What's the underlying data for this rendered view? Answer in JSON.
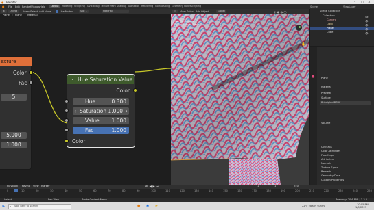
{
  "window": {
    "title": "Blender"
  },
  "menu": [
    "File",
    "Edit",
    "Render",
    "Window",
    "Help"
  ],
  "workspaces": [
    "Layout",
    "Modeling",
    "Sculpting",
    "UV Editing",
    "Texture Paint",
    "Shading",
    "Animation",
    "Rendering",
    "Compositing",
    "Geometry Nodes",
    "Scripting"
  ],
  "active_workspace": "Layout",
  "scene": "Scene",
  "view_layer": "ViewLayer",
  "node_editor": {
    "header": {
      "editor": "Object",
      "menus": [
        "View",
        "Select",
        "Add",
        "Node"
      ],
      "use_nodes": "Use Nodes",
      "slot": "Slot 1",
      "material": "Material"
    },
    "breadcrumb": [
      "Plane",
      "Plane",
      "Material"
    ],
    "texture_node": {
      "title": "exture",
      "outputs": [
        "Color",
        "Fac"
      ],
      "fields": [
        "5",
        "5.000",
        "1.000"
      ]
    },
    "hue_sat_node": {
      "title": "Hue Saturation Value",
      "output": "Color",
      "fields": [
        {
          "label": "Hue",
          "value": "0.300"
        },
        {
          "label": "Saturation",
          "value": "1.000"
        },
        {
          "label": "Value",
          "value": "1.000"
        },
        {
          "label": "Fac",
          "value": "1.000"
        }
      ],
      "input": "Color"
    }
  },
  "viewport": {
    "header": [
      "View",
      "Select",
      "Add",
      "Object"
    ],
    "mode": "Object Mode",
    "orientation": "Global",
    "overlay_text": "User Perspective",
    "overlay_sub": "(1) Collection | Plane",
    "options": "Options"
  },
  "outliner": {
    "title": "Scene Collection",
    "items": [
      "Collection",
      "Camera",
      "Light",
      "Plane",
      "Cube"
    ],
    "selected": "Plane"
  },
  "properties": {
    "object": "Plane",
    "material": "Material",
    "sections": [
      "Preview",
      "Surface",
      "Volume",
      "Settings",
      "Line Art",
      "Viewport Display",
      "Custom Properties"
    ],
    "fields": [
      "Principled BSDF",
      "Surface"
    ],
    "lower_sections": [
      "UV Maps",
      "Color Attributes",
      "Face Maps",
      "Attributes",
      "Normals",
      "Texture Space",
      "Remesh",
      "Geometry Data",
      "Custom Properties"
    ]
  },
  "timeline": {
    "menus": [
      "Playback",
      "Keying",
      "View",
      "Marker"
    ],
    "current_frame": "1",
    "start": "1",
    "end": "250",
    "ticks": [
      "0",
      "10",
      "20",
      "30",
      "40",
      "50",
      "60",
      "70",
      "80",
      "90",
      "100",
      "110",
      "120",
      "130",
      "140",
      "150",
      "160",
      "170",
      "180",
      "190",
      "200",
      "210",
      "220",
      "230",
      "240",
      "250"
    ]
  },
  "statusbar": {
    "left": "Select",
    "mid": "Pan View",
    "right": "Node Context Menu",
    "version": "Memory: 70.6 MiB | 3.3.0"
  },
  "taskbar": {
    "search": "Type here to search",
    "weather": "22°F Mostly sunny",
    "time": "10:05 PM",
    "date": "1/5/2023"
  },
  "colors": {
    "texture_header": "#e0703a",
    "hue_header": "#3e5a2c",
    "socket_yellow": "#c7c729",
    "socket_grey": "#a1a1a1",
    "fac_highlight": "#4772b3",
    "pattern_pink": "#e04a7c",
    "pattern_blue": "#6aa8e0"
  }
}
